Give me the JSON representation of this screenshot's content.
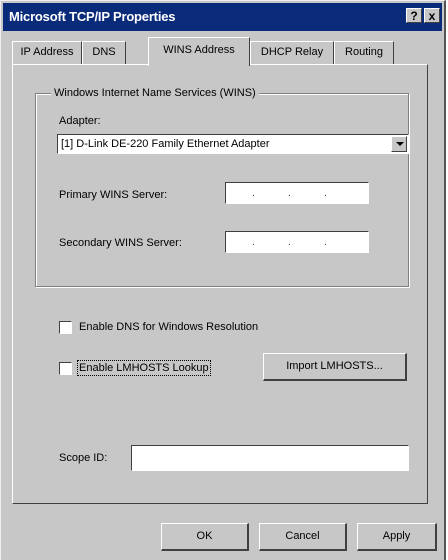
{
  "window": {
    "title": "Microsoft TCP/IP Properties",
    "help_label": "?",
    "close_label": "x"
  },
  "tabs": [
    {
      "label": "IP Address",
      "active": false
    },
    {
      "label": "DNS",
      "active": false
    },
    {
      "label": "WINS Address",
      "active": true
    },
    {
      "label": "DHCP Relay",
      "active": false
    },
    {
      "label": "Routing",
      "active": false
    }
  ],
  "wins_group": {
    "legend": "Windows Internet Name Services (WINS)",
    "adapter_label": "Adapter:",
    "adapter_value": "[1] D-Link DE-220 Family Ethernet Adapter",
    "primary_label": "Primary WINS Server:",
    "primary_value": ". . .",
    "secondary_label": "Secondary WINS Server:",
    "secondary_value": ". . ."
  },
  "options": {
    "enable_dns_label": "Enable DNS for Windows Resolution",
    "enable_dns_checked": false,
    "enable_lmhosts_label": "Enable LMHOSTS Lookup",
    "enable_lmhosts_checked": false,
    "import_button": "Import LMHOSTS..."
  },
  "scope": {
    "label": "Scope ID:",
    "value": ""
  },
  "footer": {
    "ok": "OK",
    "cancel": "Cancel",
    "apply": "Apply"
  }
}
